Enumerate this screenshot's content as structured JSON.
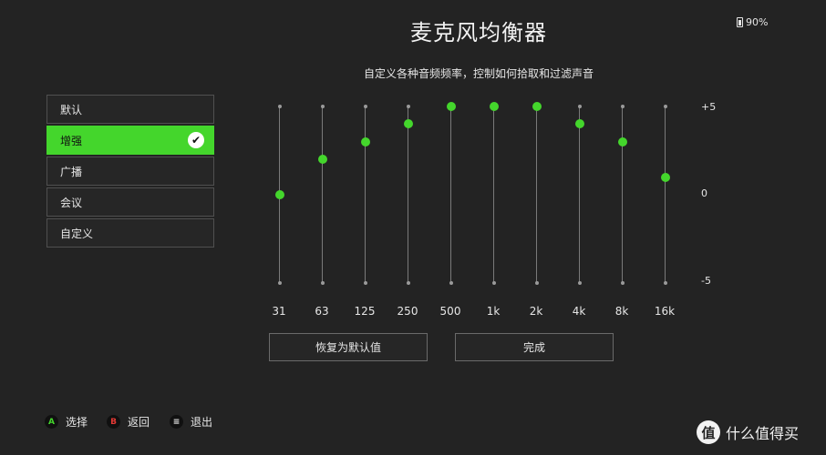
{
  "header": {
    "title": "麦克风均衡器",
    "subtitle": "自定义各种音频频率，控制如何拾取和过滤声音",
    "battery": "90%"
  },
  "presets": [
    {
      "label": "默认",
      "selected": false
    },
    {
      "label": "增强",
      "selected": true
    },
    {
      "label": "广播",
      "selected": false
    },
    {
      "label": "会议",
      "selected": false
    },
    {
      "label": "自定义",
      "selected": false
    }
  ],
  "equalizer": {
    "range": [
      -5,
      5
    ],
    "scale_labels": {
      "top": "+5",
      "mid": "0",
      "bottom": "-5"
    },
    "bands": [
      {
        "freq": "31",
        "value": 0
      },
      {
        "freq": "63",
        "value": 2
      },
      {
        "freq": "125",
        "value": 3
      },
      {
        "freq": "250",
        "value": 4
      },
      {
        "freq": "500",
        "value": 5
      },
      {
        "freq": "1k",
        "value": 5
      },
      {
        "freq": "2k",
        "value": 5
      },
      {
        "freq": "4k",
        "value": 4
      },
      {
        "freq": "8k",
        "value": 3
      },
      {
        "freq": "16k",
        "value": 1
      }
    ],
    "accent_color": "#44d62c"
  },
  "buttons": {
    "reset_label": "恢复为默认值",
    "done_label": "完成"
  },
  "footer": {
    "select": {
      "key": "A",
      "label": "选择",
      "color": "#44d62c"
    },
    "back": {
      "key": "B",
      "label": "返回",
      "color": "#e53935"
    },
    "exit": {
      "key": "≡",
      "label": "退出",
      "color": "#e6e6e6"
    }
  },
  "watermark": {
    "logo": "值",
    "text": "什么值得买"
  }
}
